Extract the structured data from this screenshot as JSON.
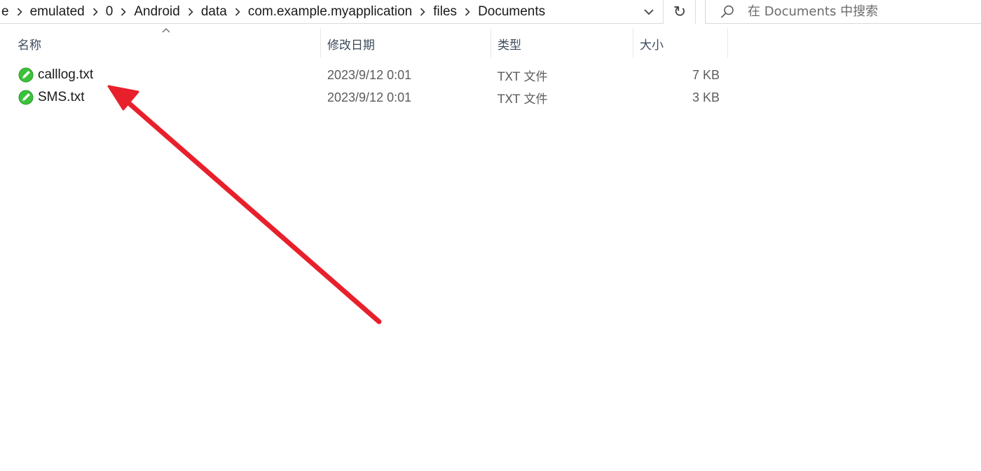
{
  "address_bar": {
    "breadcrumbs": [
      "e",
      "emulated",
      "0",
      "Android",
      "data",
      "com.example.myapplication",
      "files",
      "Documents"
    ],
    "history_dropdown_icon": "chevron-down-icon",
    "refresh_icon": "refresh-icon",
    "refresh_glyph": "↻"
  },
  "search": {
    "placeholder": "在 Documents 中搜索",
    "icon": "search-icon"
  },
  "columns": {
    "name": "名称",
    "modified": "修改日期",
    "type": "类型",
    "size": "大小"
  },
  "files": [
    {
      "name": "calllog.txt",
      "modified": "2023/9/12 0:01",
      "type": "TXT 文件",
      "size": "7 KB",
      "icon": "text-file-icon"
    },
    {
      "name": "SMS.txt",
      "modified": "2023/9/12 0:01",
      "type": "TXT 文件",
      "size": "3 KB",
      "icon": "text-file-icon"
    }
  ],
  "colors": {
    "annotation_arrow": "#e8202c",
    "file_icon_green": "#3cc13b"
  }
}
